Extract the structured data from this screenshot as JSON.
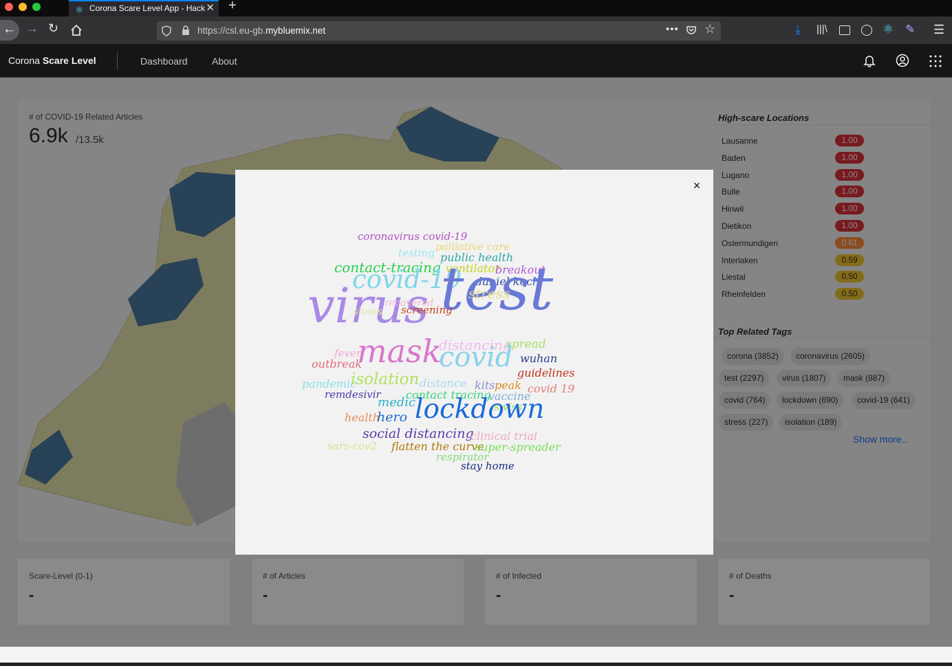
{
  "browser": {
    "tab_title": "Corona Scare Level App - Hack",
    "url_prefix": "https://csl.eu-gb.",
    "url_domain": "mybluemix.net"
  },
  "header": {
    "brand_plain": "Corona ",
    "brand_bold": "Scare Level",
    "nav": [
      "Dashboard",
      "About"
    ]
  },
  "map_card": {
    "label": "# of COVID-19 Related Articles",
    "value": "6.9k",
    "total": "/13.5k"
  },
  "locations": {
    "title": "High-scare Locations",
    "items": [
      {
        "name": "Lausanne",
        "score": "1.00",
        "color": "#da1e28"
      },
      {
        "name": "Baden",
        "score": "1.00",
        "color": "#da1e28"
      },
      {
        "name": "Lugano",
        "score": "1.00",
        "color": "#da1e28"
      },
      {
        "name": "Bulle",
        "score": "1.00",
        "color": "#da1e28"
      },
      {
        "name": "Hinwil",
        "score": "1.00",
        "color": "#da1e28"
      },
      {
        "name": "Dietikon",
        "score": "1.00",
        "color": "#da1e28"
      },
      {
        "name": "Ostermundigen",
        "score": "0.61",
        "color": "#ff832b"
      },
      {
        "name": "Interlaken",
        "score": "0.59",
        "color": "#f1c21b"
      },
      {
        "name": "Liestal",
        "score": "0.50",
        "color": "#f1c21b"
      },
      {
        "name": "Rheinfelden",
        "score": "0.50",
        "color": "#f1c21b"
      }
    ]
  },
  "tags": {
    "title": "Top Related Tags",
    "rows": [
      [
        "corona (3852)",
        "coronavirus (2605)"
      ],
      [
        "test (2297)",
        "virus (1807)",
        "mask (887)"
      ],
      [
        "covid (764)",
        "lockdown (690)",
        "covid-19 (641)"
      ],
      [
        "stress (227)",
        "isolation (189)"
      ]
    ],
    "show_more": "Show more.."
  },
  "stat_cards": [
    {
      "label": "Scare-Level (0-1)",
      "value": "-"
    },
    {
      "label": "# of Articles",
      "value": "-"
    },
    {
      "label": "# of Infected",
      "value": "-"
    },
    {
      "label": "# of Deaths",
      "value": "-"
    }
  ],
  "modal": {
    "close": "×",
    "words": [
      {
        "text": "coronavirus covid-19",
        "color": "#b44fc4"
      },
      {
        "text": "palliative care",
        "color": "#e8d77a"
      },
      {
        "text": "testing",
        "color": "#9be3f2"
      },
      {
        "text": "public health",
        "color": "#2ea7a0"
      },
      {
        "text": "contact-tracing",
        "color": "#22d14a"
      },
      {
        "text": "ventilator",
        "color": "#c9d21a"
      },
      {
        "text": "breakout",
        "color": "#b05ad8"
      },
      {
        "text": "covid-19",
        "color": "#7fd6ea"
      },
      {
        "text": "daniel koch",
        "color": "#3a4da8"
      },
      {
        "text": "virus",
        "color": "#a98ae6"
      },
      {
        "text": "test",
        "color": "#6a79d6"
      },
      {
        "text": "stress",
        "color": "#e0d98a"
      },
      {
        "text": "recovered",
        "color": "#f0b8d0"
      },
      {
        "text": "shoes",
        "color": "#e8e0a0"
      },
      {
        "text": "screening",
        "color": "#c7401a"
      },
      {
        "text": "fever",
        "color": "#f0a8d8"
      },
      {
        "text": "mask",
        "color": "#d877c9"
      },
      {
        "text": "distancing",
        "color": "#f2b8f0"
      },
      {
        "text": "spread",
        "color": "#a8e06a"
      },
      {
        "text": "outbreak",
        "color": "#e06a7a"
      },
      {
        "text": "covid",
        "color": "#8ad2ea"
      },
      {
        "text": "wuhan",
        "color": "#283a8a"
      },
      {
        "text": "guidelines",
        "color": "#c0321a"
      },
      {
        "text": "pandemic",
        "color": "#8ae0ea"
      },
      {
        "text": "isolation",
        "color": "#b0e25a"
      },
      {
        "text": "distance",
        "color": "#a8d8f0"
      },
      {
        "text": "kits",
        "color": "#8a8ad8"
      },
      {
        "text": "peak",
        "color": "#e08a1a"
      },
      {
        "text": "covid 19",
        "color": "#e08070"
      },
      {
        "text": "remdesivir",
        "color": "#4a3aa8"
      },
      {
        "text": "contact tracing",
        "color": "#3ad07a"
      },
      {
        "text": "vaccine",
        "color": "#7ab0d8"
      },
      {
        "text": "medic",
        "color": "#2ab0c8"
      },
      {
        "text": "swiss",
        "color": "#9ad85a"
      },
      {
        "text": "lockdown",
        "color": "#1a6ad8"
      },
      {
        "text": "health",
        "color": "#e0905a"
      },
      {
        "text": "hero",
        "color": "#1a6ac8"
      },
      {
        "text": "social distancing",
        "color": "#5a3aa8"
      },
      {
        "text": "clinical trial",
        "color": "#f0a8b8"
      },
      {
        "text": "sars-cov2",
        "color": "#e0e08a"
      },
      {
        "text": "flatten the curve",
        "color": "#b07a0a"
      },
      {
        "text": "super-spreader",
        "color": "#7ae05a"
      },
      {
        "text": "respirator",
        "color": "#8ad87a"
      },
      {
        "text": "stay home",
        "color": "#1a2a7a"
      }
    ]
  }
}
